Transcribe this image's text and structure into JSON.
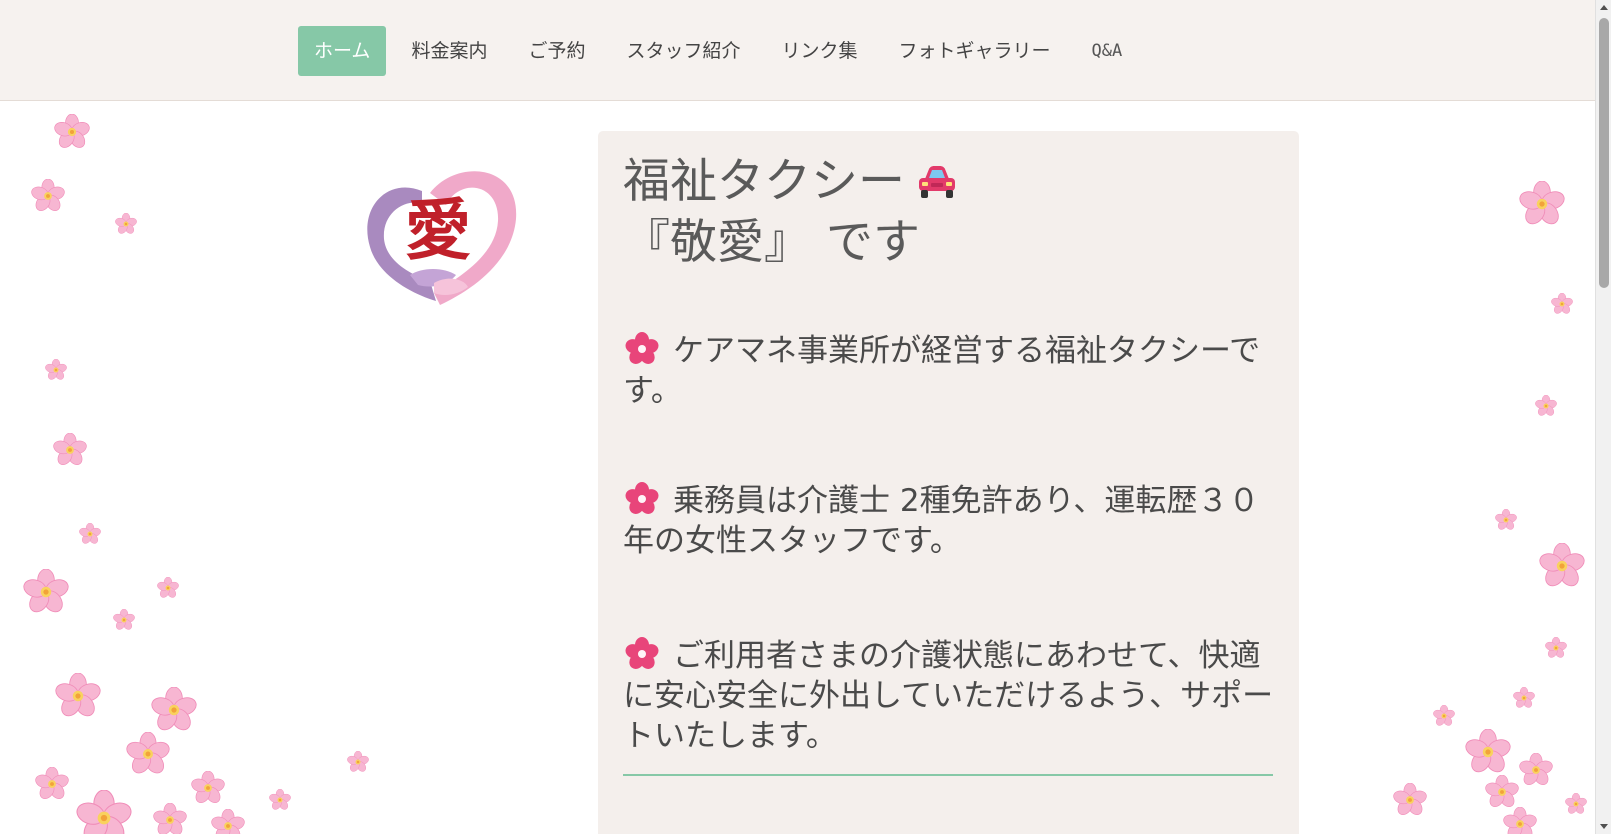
{
  "nav": {
    "items": [
      {
        "label": "ホーム",
        "active": true
      },
      {
        "label": "料金案内",
        "active": false
      },
      {
        "label": "ご予約",
        "active": false
      },
      {
        "label": "スタッフ紹介",
        "active": false
      },
      {
        "label": "リンク集",
        "active": false
      },
      {
        "label": "フォトギャラリー",
        "active": false
      },
      {
        "label": "Q&A",
        "active": false
      }
    ],
    "active_color": "#86c8a7"
  },
  "logo": {
    "icon": "heart-hands-logo",
    "text": "愛",
    "colors": {
      "left": "#a98abf",
      "right": "#f0a9c9",
      "text": "#c0202a"
    }
  },
  "main": {
    "title_line1": "福祉タクシー",
    "title_line2": "『敬愛』 です",
    "title_icon": "car-icon",
    "paragraphs": [
      {
        "icon": "sakura-icon",
        "text": "ケアマネ事業所が経営する福祉タクシーです。"
      },
      {
        "icon": "sakura-icon",
        "text": "乗務員は介護士 2種免許あり、運転歴３０年の女性スタッフです。"
      },
      {
        "icon": "sakura-icon",
        "text": "ご利用者さまの介護状態にあわせて、快適に安心安全に外出していただけるよう、サポートいたします。"
      }
    ],
    "card_color": "#f4efec",
    "rule_color": "#86c8a7"
  },
  "background": {
    "decoration": "cherry-blossoms",
    "blossom_color": "#f7b6d2"
  }
}
